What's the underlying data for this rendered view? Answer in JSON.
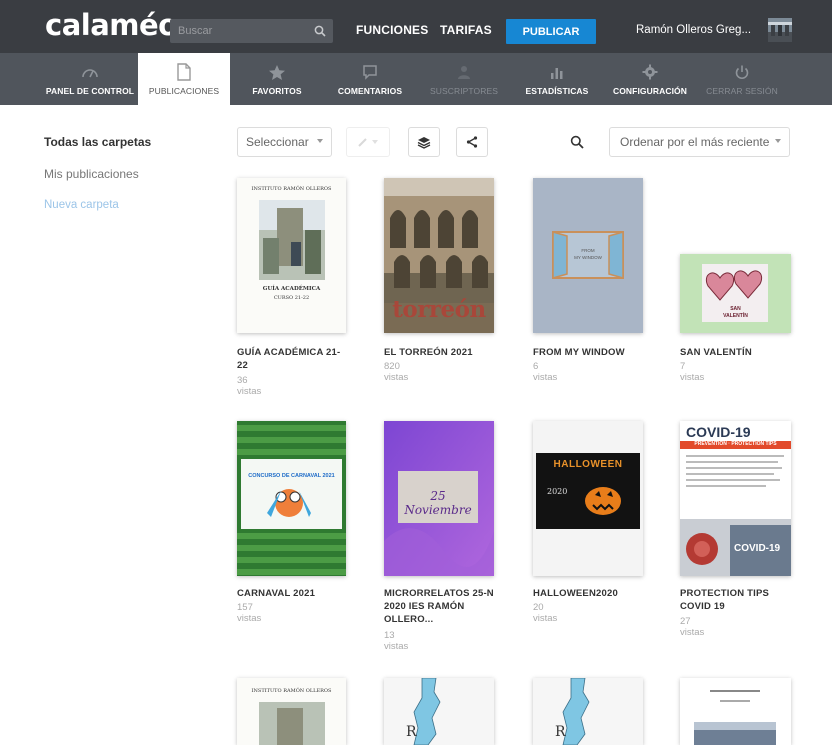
{
  "header": {
    "logo": "calaméo",
    "search_placeholder": "Buscar",
    "nav": [
      "FUNCIONES",
      "TARIFAS"
    ],
    "publish_label": "PUBLICAR",
    "user_name": "Ramón Olleros Greg..."
  },
  "subnav": [
    {
      "label": "PANEL DE CONTROL",
      "icon": "gauge-icon"
    },
    {
      "label": "PUBLICACIONES",
      "icon": "document-icon"
    },
    {
      "label": "FAVORITOS",
      "icon": "star-icon"
    },
    {
      "label": "COMENTARIOS",
      "icon": "comment-icon"
    },
    {
      "label": "SUSCRIPTORES",
      "icon": "user-icon"
    },
    {
      "label": "ESTADÍSTICAS",
      "icon": "bar-chart-icon"
    },
    {
      "label": "CONFIGURACIÓN",
      "icon": "gear-icon"
    },
    {
      "label": "CERRAR SESIÓN",
      "icon": "power-icon"
    }
  ],
  "sidebar": {
    "all_folders": "Todas las carpetas",
    "my_publications": "Mis publicaciones",
    "new_folder": "Nueva carpeta"
  },
  "toolbar": {
    "select_label": "Seleccionar",
    "sort_label": "Ordenar por el más reciente"
  },
  "publications": [
    {
      "title": "GUÍA ACADÉMICA 21-22",
      "views": "36 vistas",
      "cover_text": [
        "INSTITUTO RAMÓN OLLEROS",
        "GUÍA ACADÉMICA",
        "CURSO 21-22"
      ]
    },
    {
      "title": "EL TORREÓN 2021",
      "views": "820 vistas",
      "cover_text": [
        "torreón"
      ]
    },
    {
      "title": "FROM MY WINDOW",
      "views": "6 vistas",
      "cover_text": [
        "FROM",
        "MY WINDOW"
      ]
    },
    {
      "title": "SAN VALENTÍN",
      "views": "7 vistas",
      "cover_text": [
        "SAN",
        "VALENTÍN"
      ]
    },
    {
      "title": "CARNAVAL 2021",
      "views": "157 vistas",
      "cover_text": [
        "CONCURSO DE CARNAVAL 2021"
      ]
    },
    {
      "title": "MICRORRELATOS 25-N 2020 IES RAMÓN OLLERO...",
      "views": "13 vistas",
      "cover_text": [
        "25 Noviembre"
      ]
    },
    {
      "title": "HALLOWEEN2020",
      "views": "20 vistas",
      "cover_text": [
        "HALLOWEEN",
        "2020"
      ]
    },
    {
      "title": "PROTECTION TIPS COVID 19",
      "views": "27 vistas",
      "cover_text": [
        "COVID-19",
        "PREVENTION · PROTECTION TIPS",
        "COVID-19"
      ]
    },
    {
      "title": "",
      "views": "",
      "cover_text": [
        "INSTITUTO RAMÓN OLLEROS"
      ]
    },
    {
      "title": "",
      "views": "",
      "cover_text": [
        "R"
      ]
    },
    {
      "title": "",
      "views": "",
      "cover_text": [
        "R"
      ]
    },
    {
      "title": "",
      "views": "",
      "cover_text": []
    }
  ],
  "colors": {
    "topbar": "#3a3d42",
    "subnav": "#50555c",
    "accent": "#1787d3"
  }
}
